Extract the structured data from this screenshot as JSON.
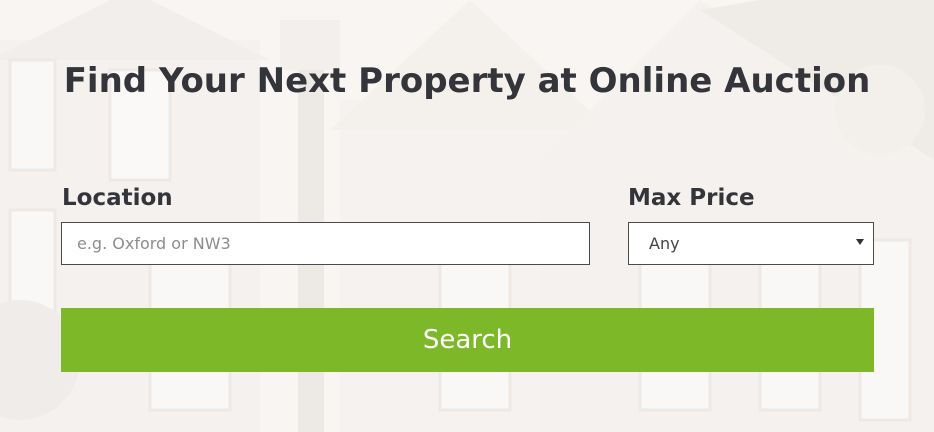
{
  "hero": {
    "title": "Find Your Next Property at Online Auction"
  },
  "search_form": {
    "location": {
      "label": "Location",
      "value": "",
      "placeholder": "e.g. Oxford or NW3"
    },
    "max_price": {
      "label": "Max Price",
      "selected": "Any"
    },
    "search_button_label": "Search"
  },
  "colors": {
    "accent": "#7db828",
    "heading_text": "#33353a",
    "field_border": "#4a4a4a"
  },
  "icons": {
    "select_caret": "chevron-down-icon"
  }
}
